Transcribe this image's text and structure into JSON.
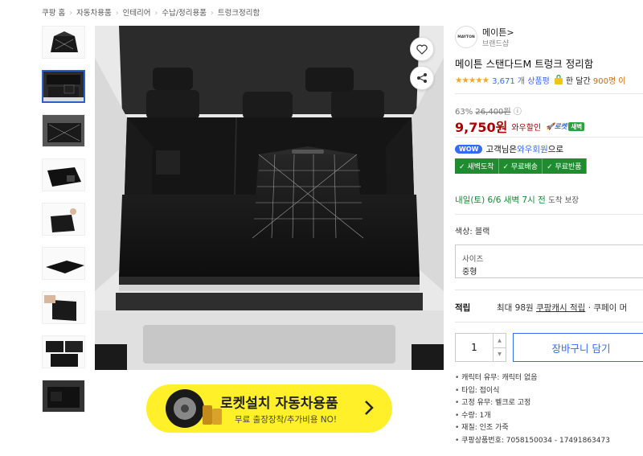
{
  "breadcrumb": [
    "쿠팡 홈",
    "자동차용품",
    "인테리어",
    "수납/정리용품",
    "트렁크정리함"
  ],
  "brand": {
    "logo_text": "MAYTON",
    "name": "메이튼",
    "shop": "브랜드샵"
  },
  "product": {
    "title": "메이튼 스탠다드M 트렁크 정리함",
    "stars": "★★★★★",
    "rating_count": "3,671 개 상품평",
    "recent_purchase_prefix": "한 달간",
    "recent_purchase_count": "900명 이",
    "discount_rate": "63%",
    "original_price": "26,400원",
    "price": "9,750원",
    "price_label": "와우할인",
    "rocket_label": "🚀로켓",
    "rocket_dawn": "새벽"
  },
  "wow": {
    "badge": "WOW",
    "text_before": "고객님은 ",
    "link": "와우회원",
    "text_after": "으로"
  },
  "benefits": [
    "✓ 새벽도착",
    "✓ 무료배송",
    "✓ 무료반품"
  ],
  "delivery": {
    "main": "내일(토) 6/6 새벽 7시 전",
    "note": "도착 보장"
  },
  "options": {
    "color_label": "색상: 블랙",
    "size_label": "사이즈",
    "size_value": "중형"
  },
  "points": {
    "label": "적립",
    "text": "최대 98원",
    "link": "쿠팡캐시 적립",
    "extra": "· 쿠페이 머"
  },
  "quantity": {
    "value": "1",
    "up": "▲",
    "down": "▼"
  },
  "cart_button": "장바구니 담기",
  "details": [
    "캐릭터 유무: 캐릭터 없음",
    "타입: 접이식",
    "고정 유무: 벨크로 고정",
    "수량: 1개",
    "재질: 인조 가죽",
    "쿠팡상품번호: 7058150034 - 17491863473"
  ],
  "banner": {
    "title": "로켓설치 자동차용품",
    "subtitle": "무료 출장장착/추가비용 NO!"
  },
  "colors": {
    "accent": "#346aff",
    "price": "#ae0000",
    "banner": "#fff02a",
    "benefit": "#1e8c2f"
  }
}
